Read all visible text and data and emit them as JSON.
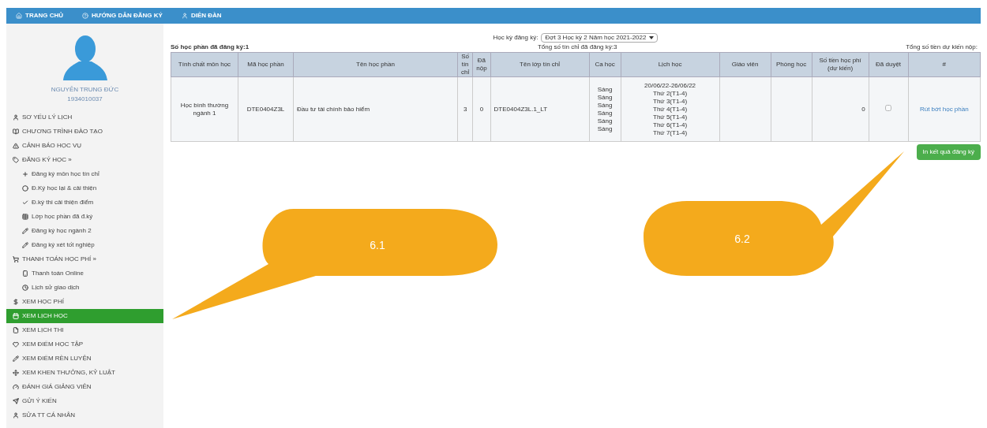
{
  "nav": [
    {
      "label": "TRANG CHỦ"
    },
    {
      "label": "HƯỚNG DẪN ĐĂNG KÝ"
    },
    {
      "label": "DIỄN ĐÀN"
    }
  ],
  "profile": {
    "name": "NGUYỄN TRUNG ĐỨC",
    "id": "1934010037"
  },
  "sidebar": {
    "items": [
      {
        "label": "SƠ YẾU LÝ LỊCH",
        "selected": false
      },
      {
        "label": "CHƯƠNG TRÌNH ĐÀO TẠO",
        "selected": false
      },
      {
        "label": "CẢNH BÁO HỌC VỤ",
        "selected": false
      },
      {
        "label": "ĐĂNG KÝ HỌC »",
        "selected": false,
        "children": [
          {
            "label": "Đăng ký môn học tín chỉ",
            "selected": false
          },
          {
            "label": "Đ.Ký học lại & cải thiện",
            "selected": false
          },
          {
            "label": "Đ.ký thi cải thiện điểm",
            "selected": false
          },
          {
            "label": "Lớp học phần đã đ.ký",
            "selected": false
          },
          {
            "label": "Đăng ký học ngành 2",
            "selected": false
          },
          {
            "label": "Đăng ký xét tốt nghiệp",
            "selected": false
          }
        ]
      },
      {
        "label": "THANH TOÁN HỌC PHÍ »",
        "selected": false,
        "children": [
          {
            "label": "Thanh toán Online",
            "selected": false
          },
          {
            "label": "Lịch sử giao dịch",
            "selected": false
          }
        ]
      },
      {
        "label": "XEM HỌC PHÍ",
        "selected": false
      },
      {
        "label": "XEM LỊCH HỌC",
        "selected": true
      },
      {
        "label": "XEM LỊCH THI",
        "selected": false
      },
      {
        "label": "XEM ĐIỂM HỌC TẬP",
        "selected": false
      },
      {
        "label": "XEM ĐIỂM RÈN LUYỆN",
        "selected": false
      },
      {
        "label": "XEM KHEN THƯỞNG, KỶ LUẬT",
        "selected": false
      },
      {
        "label": "ĐÁNH GIÁ GIẢNG VIÊN",
        "selected": false
      },
      {
        "label": "GỬI Ý KIẾN",
        "selected": false
      },
      {
        "label": "SỬA TT CÁ NHÂN",
        "selected": false
      }
    ]
  },
  "semester": {
    "label": "Học kỳ đăng ký:",
    "value": "Đợt 3 Học kỳ 2 Năm học 2021-2022"
  },
  "summary": {
    "courses": "Số học phần đã đăng ký:1",
    "credits": "Tổng số tín chỉ đã đăng ký:3",
    "fee": "Tổng số tiền dự kiến nộp:"
  },
  "table": {
    "columns": [
      "Tính chất môn học",
      "Mã học phần",
      "Tên học phần",
      "Số tín chỉ",
      "Đã nộp",
      "Tên lớp tín chỉ",
      "Ca học",
      "Lịch học",
      "Giáo viên",
      "Phòng học",
      "Số tiền học phí (dự kiến)",
      "Đã duyệt",
      "#"
    ],
    "rows": [
      {
        "type": "Học bình thường ngành 1",
        "code": "DTE0404Z3L",
        "name": "Đầu tư tài chính bảo hiểm",
        "credits": "3",
        "paid": "0",
        "class": "DTE0404Z3L.1_LT",
        "shifts": [
          "Sáng",
          "Sáng",
          "Sáng",
          "Sáng",
          "Sáng",
          "Sáng"
        ],
        "schedule": [
          "20/06/22-26/06/22",
          "Thứ 2(T1-4)",
          "Thứ 3(T1-4)",
          "Thứ 4(T1-4)",
          "Thứ 5(T1-4)",
          "Thứ 6(T1-4)",
          "Thứ 7(T1-4)"
        ],
        "fee": "0",
        "approved": false,
        "action": "Rút bớt học phần"
      }
    ]
  },
  "print_button": "In kết quả đăng ký",
  "callouts": [
    {
      "label": "6.1"
    },
    {
      "label": "6.2"
    }
  ]
}
